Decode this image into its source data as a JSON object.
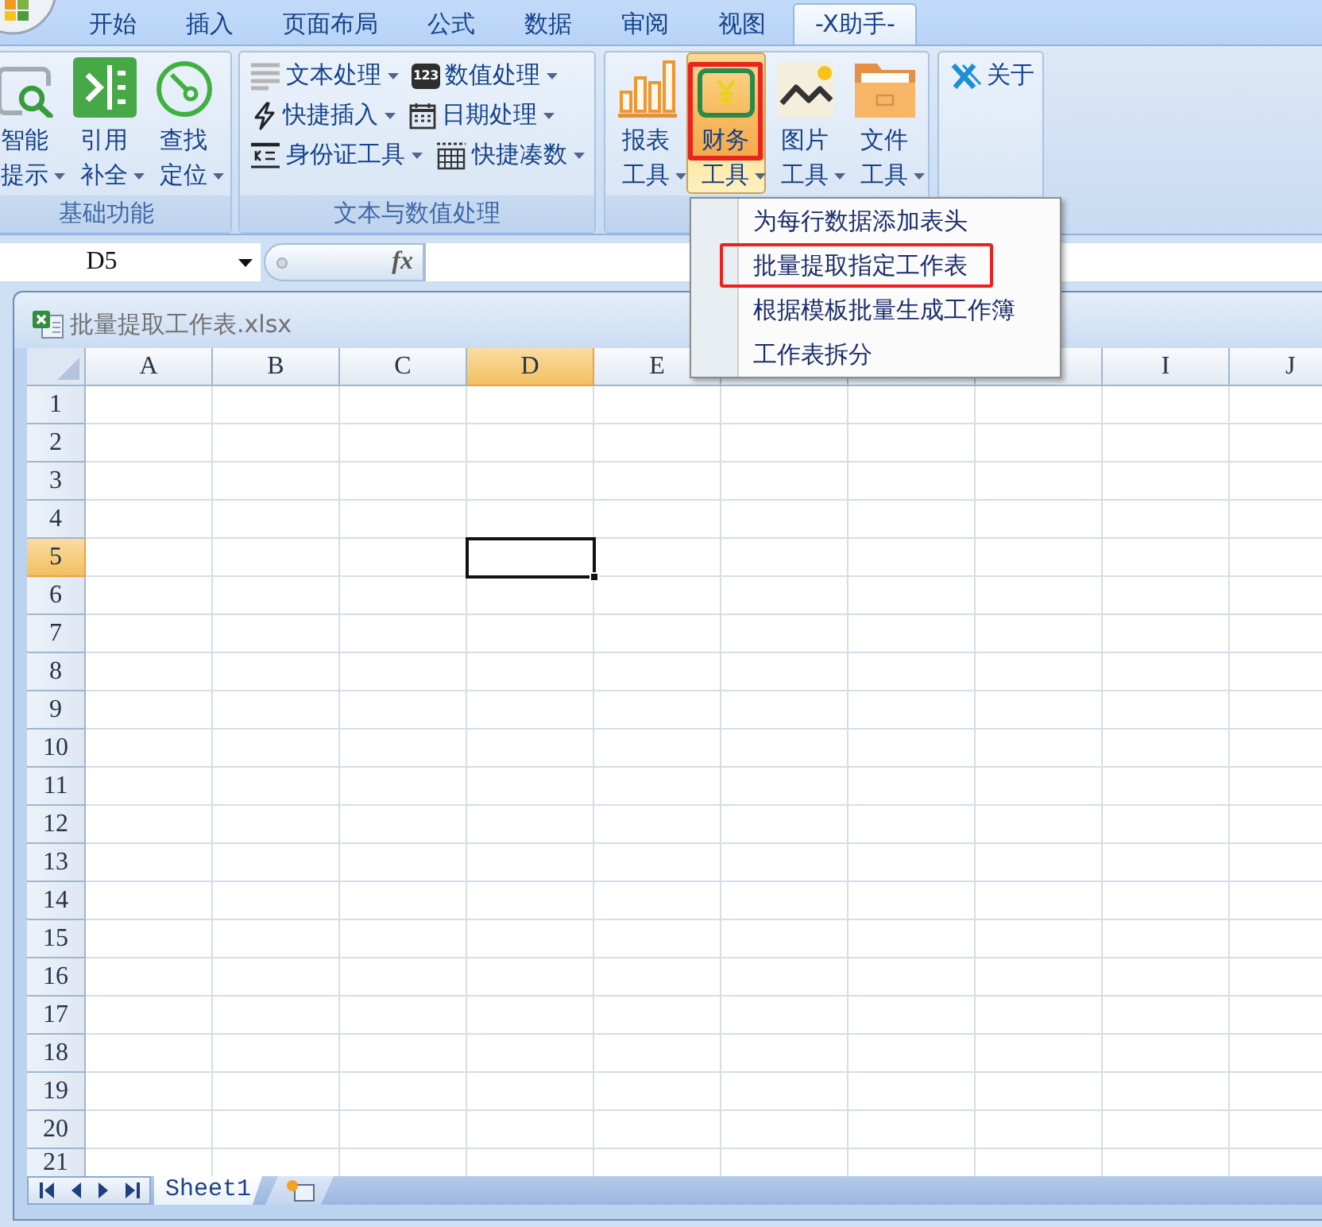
{
  "tabs": [
    {
      "label": "开始",
      "selected": false
    },
    {
      "label": "插入",
      "selected": false
    },
    {
      "label": "页面布局",
      "selected": false
    },
    {
      "label": "公式",
      "selected": false
    },
    {
      "label": "数据",
      "selected": false
    },
    {
      "label": "审阅",
      "selected": false
    },
    {
      "label": "视图",
      "selected": false
    },
    {
      "label": "-X助手-",
      "selected": true
    }
  ],
  "ribbon_groups": [
    {
      "kind": "large",
      "label": "基础功能",
      "buttons": [
        {
          "label": "智能提示",
          "dropdown": true,
          "expanded": false,
          "annotated": false
        },
        {
          "label": "引用补全",
          "dropdown": true,
          "expanded": false,
          "annotated": false
        },
        {
          "label": "查找定位",
          "dropdown": true,
          "expanded": false,
          "annotated": false
        }
      ]
    },
    {
      "kind": "small",
      "label": "文本与数值处理",
      "rows": [
        [
          {
            "label": "文本处理",
            "dropdown": true
          },
          {
            "label": "数值处理",
            "dropdown": true,
            "badge": "123"
          }
        ],
        [
          {
            "label": "快捷插入",
            "dropdown": true
          },
          {
            "label": "日期处理",
            "dropdown": true
          }
        ],
        [
          {
            "label": "身份证工具",
            "dropdown": true
          },
          {
            "label": "快捷凑数",
            "dropdown": true
          }
        ]
      ]
    },
    {
      "kind": "large",
      "buttons": [
        {
          "label": "报表工具",
          "dropdown": true,
          "expanded": false,
          "annotated": false
        },
        {
          "label": "财务工具",
          "dropdown": true,
          "expanded": true,
          "annotated": true,
          "menu": [
            {
              "label": "为每行数据添加表头",
              "annotated": false
            },
            {
              "label": "批量提取指定工作表",
              "annotated": true
            },
            {
              "label": "根据模板批量生成工作簿",
              "annotated": false
            },
            {
              "label": "工作表拆分",
              "annotated": false
            }
          ]
        },
        {
          "label": "图片工具",
          "dropdown": true,
          "expanded": false,
          "annotated": false
        },
        {
          "label": "文件工具",
          "dropdown": true,
          "expanded": false,
          "annotated": false
        }
      ]
    },
    {
      "kind": "small",
      "rows": [
        [
          {
            "label": "关于",
            "dropdown": false
          }
        ]
      ]
    }
  ],
  "name_box": {
    "value": "D5"
  },
  "formula_bar": {
    "function_button": "fx"
  },
  "workbook": {
    "title": "批量提取工作表.xlsx",
    "columns": [
      {
        "label": "A",
        "selected": false
      },
      {
        "label": "B",
        "selected": false
      },
      {
        "label": "C",
        "selected": false
      },
      {
        "label": "D",
        "selected": true
      },
      {
        "label": "E",
        "selected": false
      },
      {
        "selected": false
      },
      {
        "selected": false
      },
      {
        "selected": false
      },
      {
        "label": "I",
        "selected": false
      },
      {
        "label": "J",
        "selected": false
      }
    ],
    "rows": [
      {
        "label": "1",
        "selected": false
      },
      {
        "label": "2",
        "selected": false
      },
      {
        "label": "3",
        "selected": false
      },
      {
        "label": "4",
        "selected": false
      },
      {
        "label": "5",
        "selected": true
      },
      {
        "label": "6",
        "selected": false
      },
      {
        "label": "7",
        "selected": false
      },
      {
        "label": "8",
        "selected": false
      },
      {
        "label": "9",
        "selected": false
      },
      {
        "label": "10",
        "selected": false
      },
      {
        "label": "11",
        "selected": false
      },
      {
        "label": "12",
        "selected": false
      },
      {
        "label": "13",
        "selected": false
      },
      {
        "label": "14",
        "selected": false
      },
      {
        "label": "15",
        "selected": false
      },
      {
        "label": "16",
        "selected": false
      },
      {
        "label": "17",
        "selected": false
      },
      {
        "label": "18",
        "selected": false
      },
      {
        "label": "19",
        "selected": false
      },
      {
        "label": "20",
        "selected": false
      },
      {
        "label": "21",
        "selected": false
      }
    ],
    "sheets": [
      {
        "label": "Sheet1",
        "selected": true
      }
    ]
  }
}
